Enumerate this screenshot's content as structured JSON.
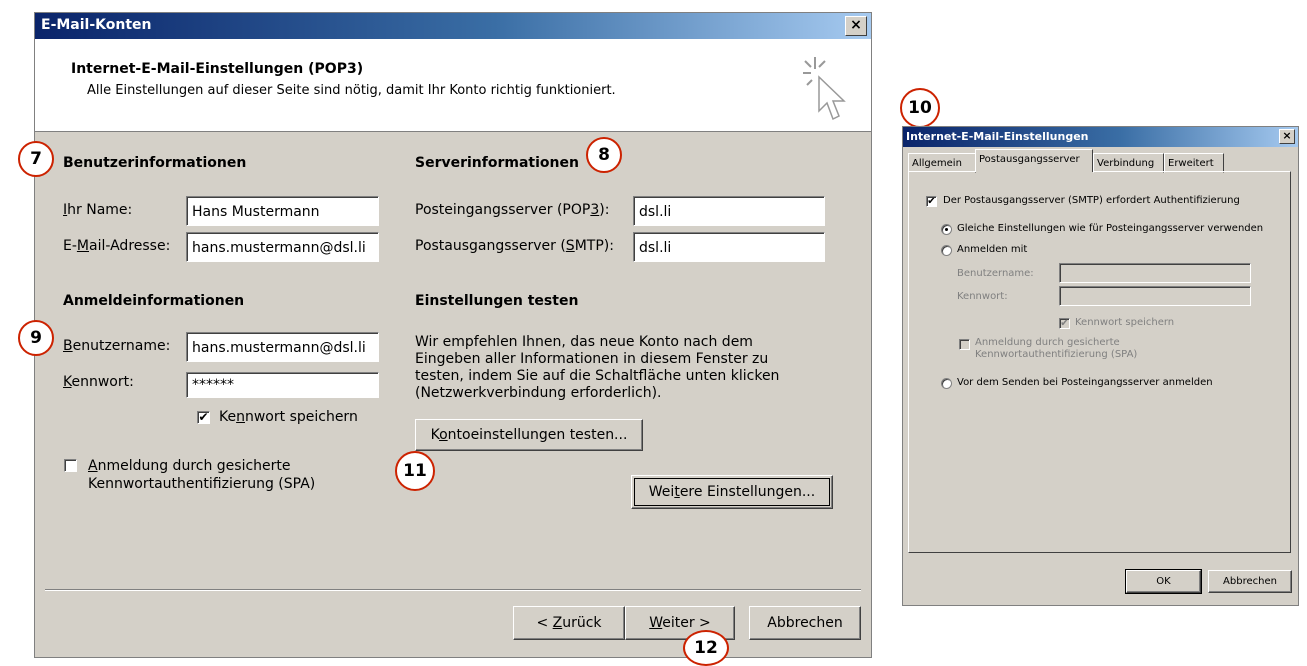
{
  "main_dialog": {
    "title": "E-Mail-Konten",
    "close_glyph": "×",
    "header": {
      "title": "Internet-E-Mail-Einstellungen (POP3)",
      "subtitle": "Alle Einstellungen auf dieser Seite sind nötig, damit Ihr Konto richtig funktioniert.",
      "icon": "cursor-sparkle-icon"
    },
    "user_info": {
      "title": "Benutzerinformationen",
      "name_label": "Ihr Name:",
      "name_value": "Hans Mustermann",
      "email_label": "E-Mail-Adresse:",
      "email_value": "hans.mustermann@dsl.li"
    },
    "server_info": {
      "title": "Serverinformationen",
      "incoming_label": "Posteingangsserver (POP3):",
      "incoming_value": "dsl.li",
      "outgoing_label": "Postausgangsserver (SMTP):",
      "outgoing_value": "dsl.li"
    },
    "logon_info": {
      "title": "Anmeldeinformationen",
      "username_label": "Benutzername:",
      "username_value": "hans.mustermann@dsl.li",
      "password_label": "Kennwort:",
      "password_value": "******",
      "remember_label": "Kennwort speichern",
      "remember_checked": true,
      "spa_label_line1": "Anmeldung durch gesicherte",
      "spa_label_line2": "Kennwortauthentifizierung (SPA)",
      "spa_checked": false
    },
    "test_settings": {
      "title": "Einstellungen testen",
      "desc_line1": "Wir empfehlen Ihnen, das neue Konto nach dem",
      "desc_line2": "Eingeben aller Informationen in diesem Fenster zu",
      "desc_line3": "testen, indem Sie auf die Schaltfläche unten klicken",
      "desc_line4": "(Netzwerkverbindung erforderlich).",
      "test_button": "Kontoeinstellungen testen...",
      "more_button": "Weitere Einstellungen..."
    },
    "nav": {
      "back": "< Zurück",
      "next": "Weiter >",
      "cancel": "Abbrechen"
    }
  },
  "markers": {
    "m7": "7",
    "m8": "8",
    "m9": "9",
    "m10": "10",
    "m11": "11",
    "m12": "12"
  },
  "smtp_dialog": {
    "title": "Internet-E-Mail-Einstellungen",
    "close_glyph": "×",
    "tabs": [
      "Allgemein",
      "Postausgangsserver",
      "Verbindung",
      "Erweitert"
    ],
    "active_tab": "Postausgangsserver",
    "requires_auth_label": "Der Postausgangsserver (SMTP) erfordert Authentifizierung",
    "requires_auth_checked": true,
    "same_settings_label": "Gleiche Einstellungen wie für Posteingangsserver verwenden",
    "same_settings_selected": true,
    "logon_with_label": "Anmelden mit",
    "username_label": "Benutzername:",
    "password_label": "Kennwort:",
    "remember_label": "Kennwort speichern",
    "spa_line1": "Anmeldung durch gesicherte",
    "spa_line2": "Kennwortauthentifizierung (SPA)",
    "before_send_label": "Vor dem Senden bei Posteingangsserver anmelden",
    "ok": "OK",
    "cancel": "Abbrechen"
  }
}
